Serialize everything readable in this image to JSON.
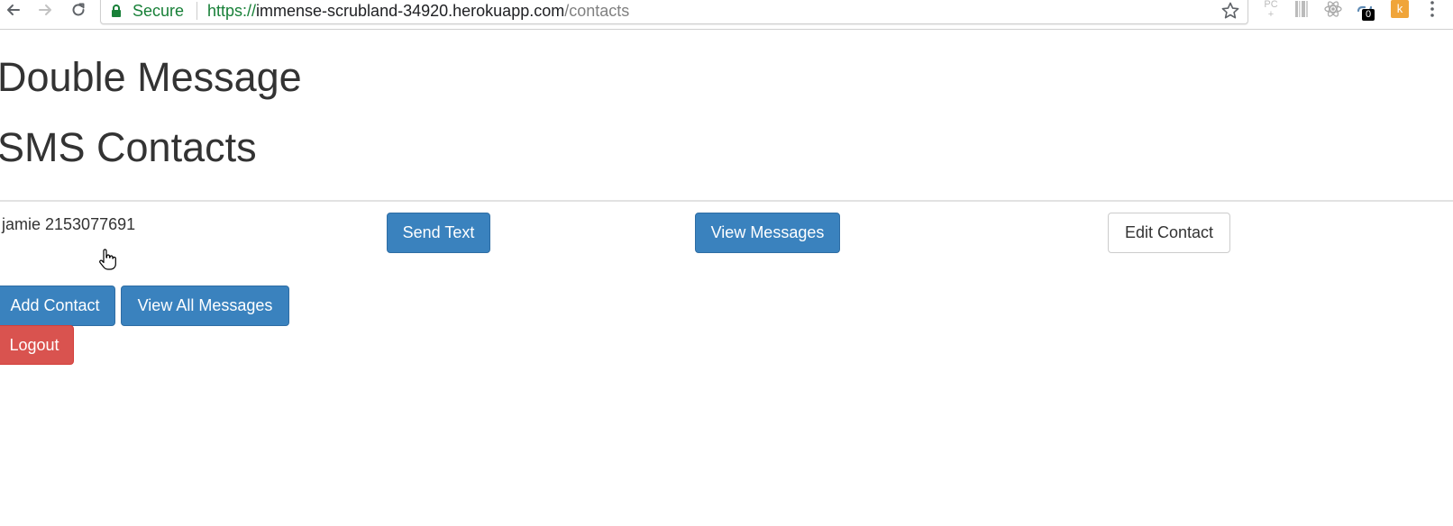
{
  "browser": {
    "secure_label": "Secure",
    "url_scheme": "https://",
    "url_host": "immense-scrubland-34920.herokuapp.com",
    "url_path": "/contacts",
    "extensions": {
      "pc_label": "PC\n+",
      "link_badge": "0",
      "k_label": "k"
    },
    "colors": {
      "secure_green": "#188038",
      "url_gray": "#808080"
    }
  },
  "page": {
    "title": "Double Message",
    "subtitle": "SMS Contacts",
    "contacts": [
      {
        "label": "jamie 2153077691",
        "send_text": "Send Text",
        "view_messages": "View Messages",
        "edit_contact": "Edit Contact"
      }
    ],
    "actions": {
      "add_contact": "Add Contact",
      "view_all_messages": "View All Messages",
      "logout": "Logout"
    },
    "colors": {
      "primary": "#3a82be",
      "danger": "#d9534f",
      "text": "#333333"
    }
  }
}
